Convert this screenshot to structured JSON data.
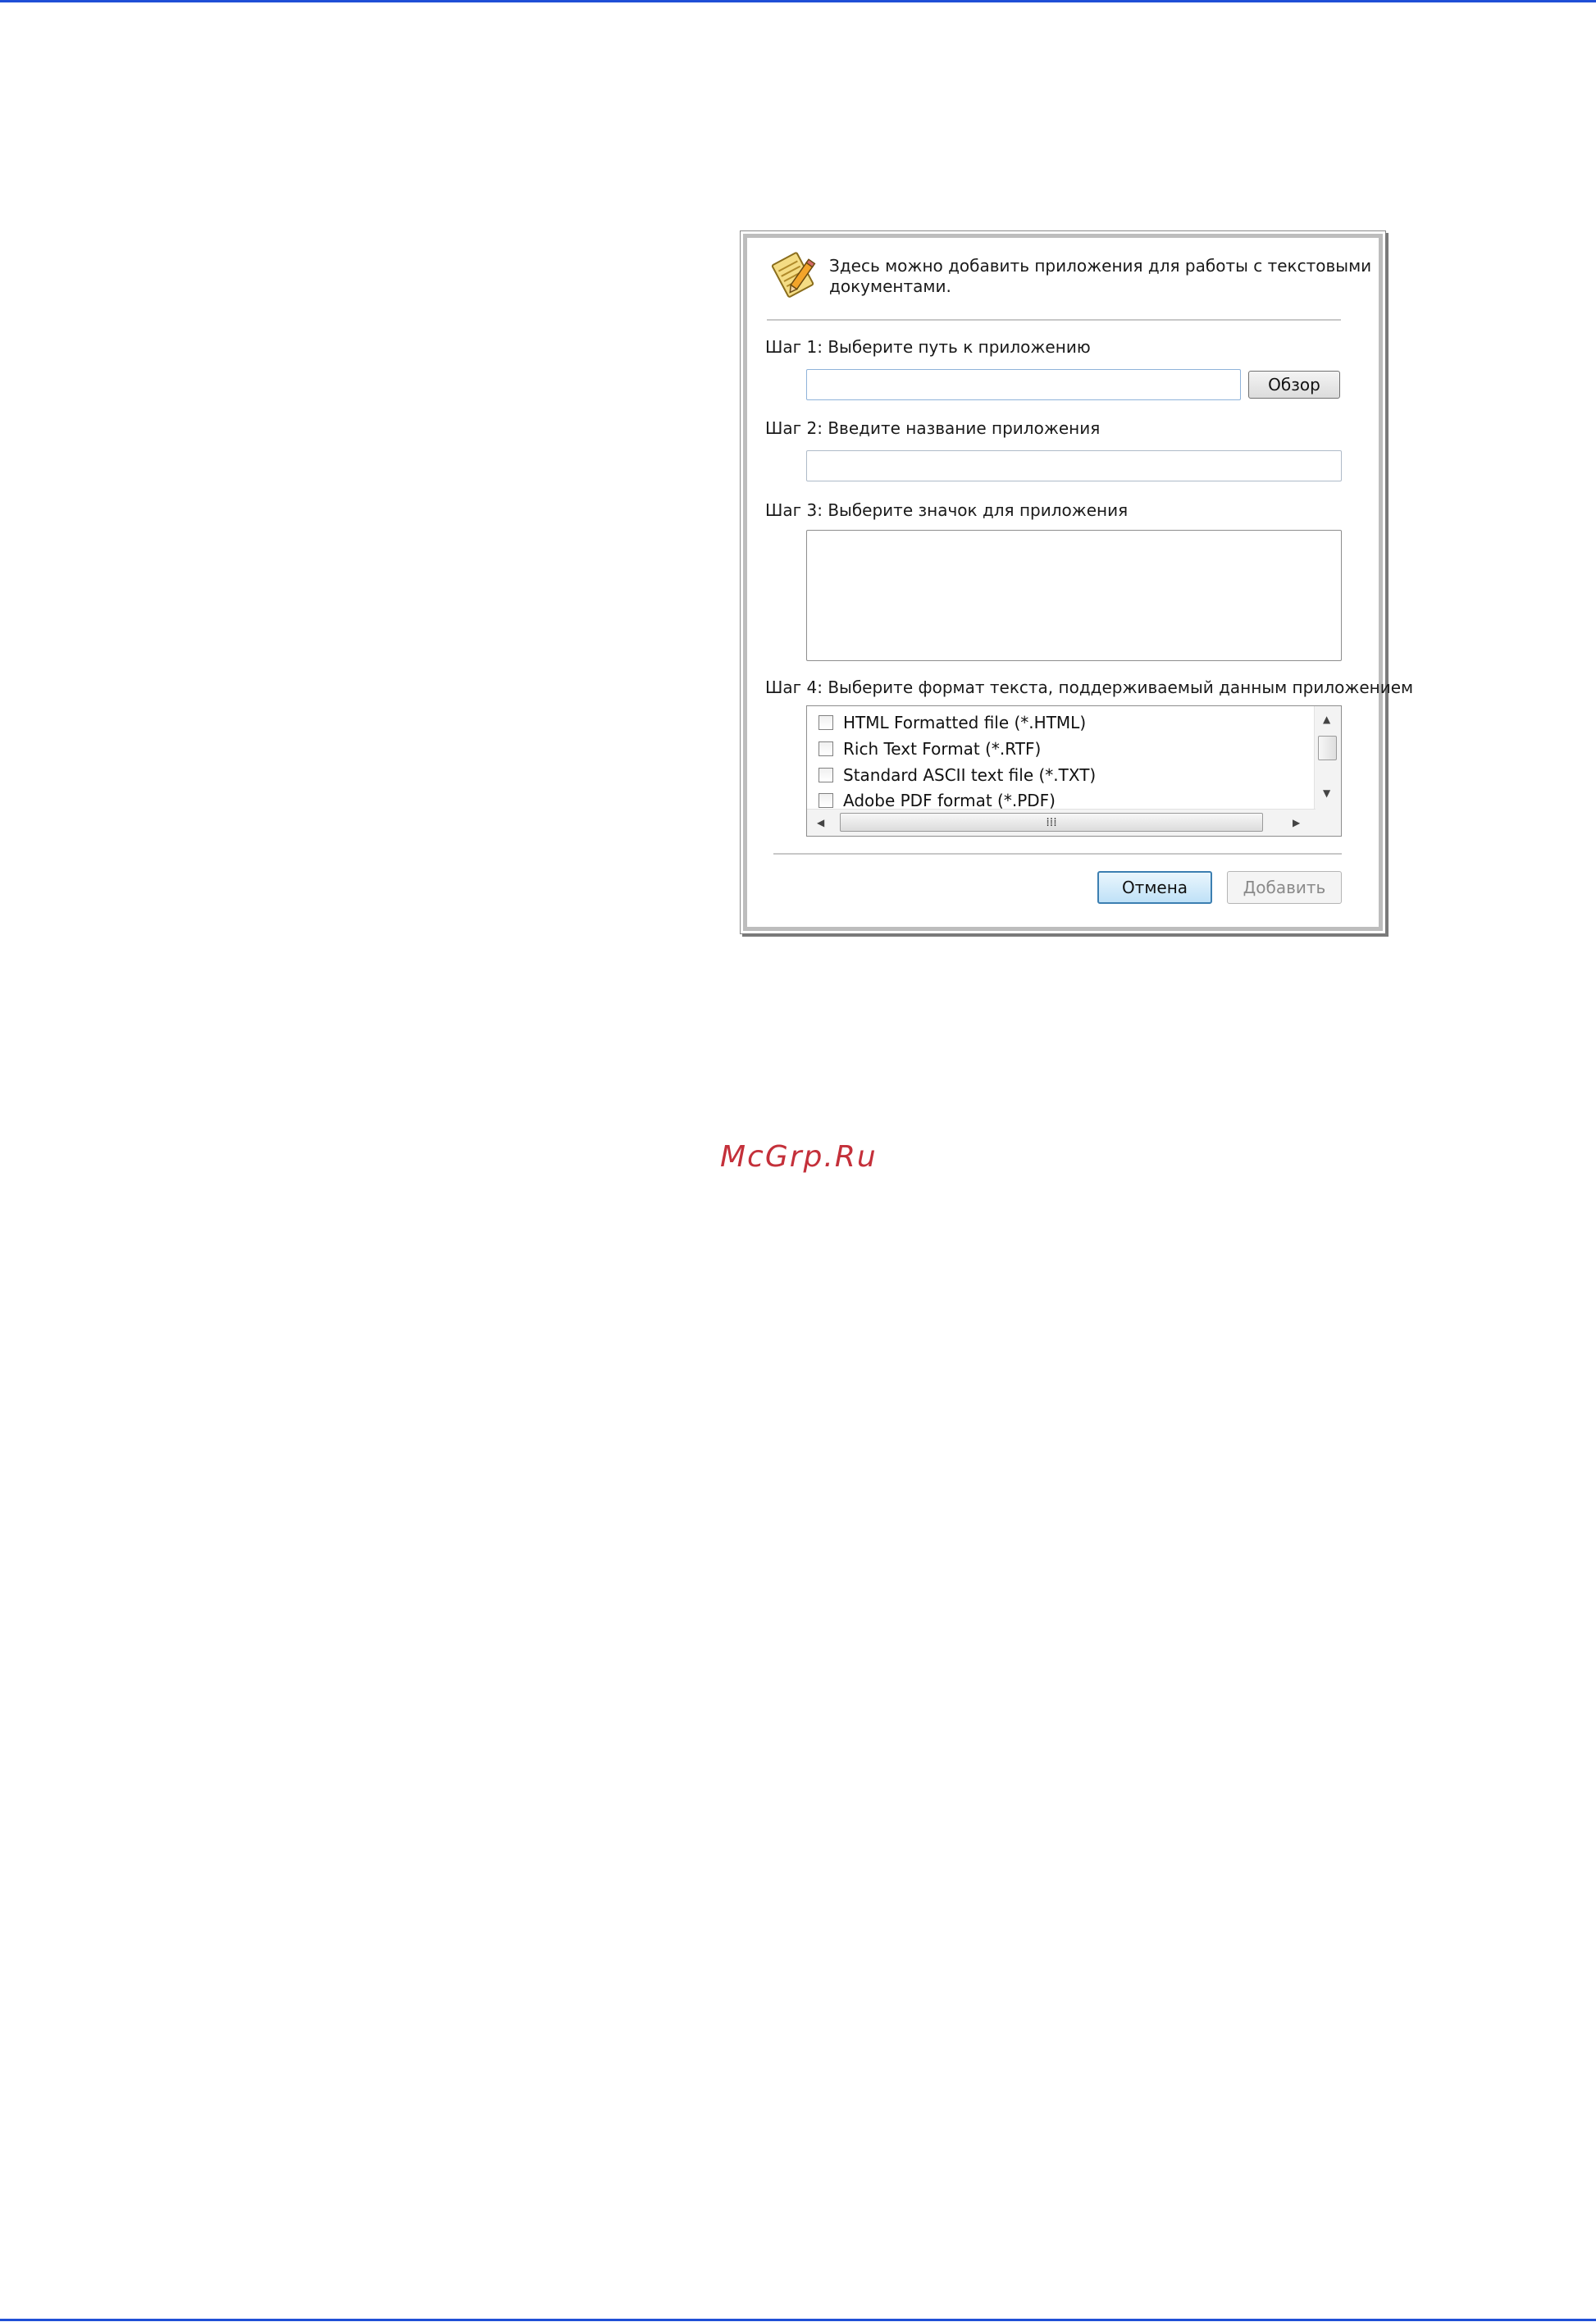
{
  "dialog": {
    "intro_line1": "Здесь можно добавить приложения для работы с текстовыми",
    "intro_line2": "документами.",
    "header_icon": "notepad-pencil-icon",
    "step1_label": "Шаг 1: Выберите путь к приложению",
    "step1_value": "",
    "browse_label": "Обзор",
    "step2_label": "Шаг 2: Введите название приложения",
    "step2_value": "",
    "step3_label": "Шаг 3: Выберите значок для приложения",
    "step4_label": "Шаг 4: Выберите формат текста, поддерживаемый данным приложением",
    "formats": [
      "HTML Formatted file (*.HTML)",
      "Rich Text Format (*.RTF)",
      "Standard ASCII text file (*.TXT)",
      "Adobe PDF format (*.PDF)"
    ],
    "cancel_label": "Отмена",
    "add_label": "Добавить"
  },
  "watermark": "McGrp.Ru",
  "colors": {
    "page_rule": "#1f4fd6",
    "watermark": "#c4303a",
    "default_button_border": "#3c7fb1"
  }
}
